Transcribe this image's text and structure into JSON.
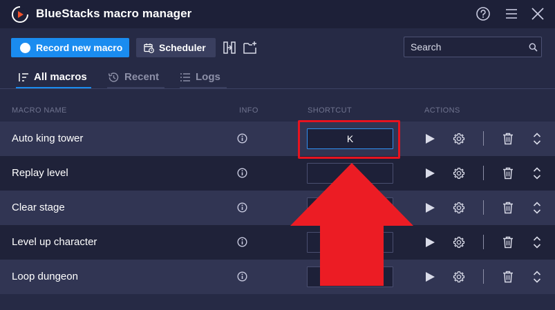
{
  "titlebar": {
    "title": "BlueStacks macro manager"
  },
  "toolbar": {
    "record_label": "Record new macro",
    "scheduler_label": "Scheduler"
  },
  "search": {
    "placeholder": "Search"
  },
  "tabs": [
    {
      "label": "All macros",
      "active": true
    },
    {
      "label": "Recent",
      "active": false
    },
    {
      "label": "Logs",
      "active": false
    }
  ],
  "columns": {
    "name": "MACRO NAME",
    "info": "INFO",
    "shortcut": "SHORTCUT",
    "actions": "ACTIONS"
  },
  "macros": [
    {
      "name": "Auto king tower",
      "shortcut": "K"
    },
    {
      "name": "Replay level",
      "shortcut": ""
    },
    {
      "name": "Clear stage",
      "shortcut": ""
    },
    {
      "name": "Level up character",
      "shortcut": ""
    },
    {
      "name": "Loop dungeon",
      "shortcut": ""
    }
  ],
  "colors": {
    "accent": "#1a8cf0",
    "background": "#262a45",
    "titlebar": "#1d2038",
    "annotation_red": "#e8131f"
  }
}
